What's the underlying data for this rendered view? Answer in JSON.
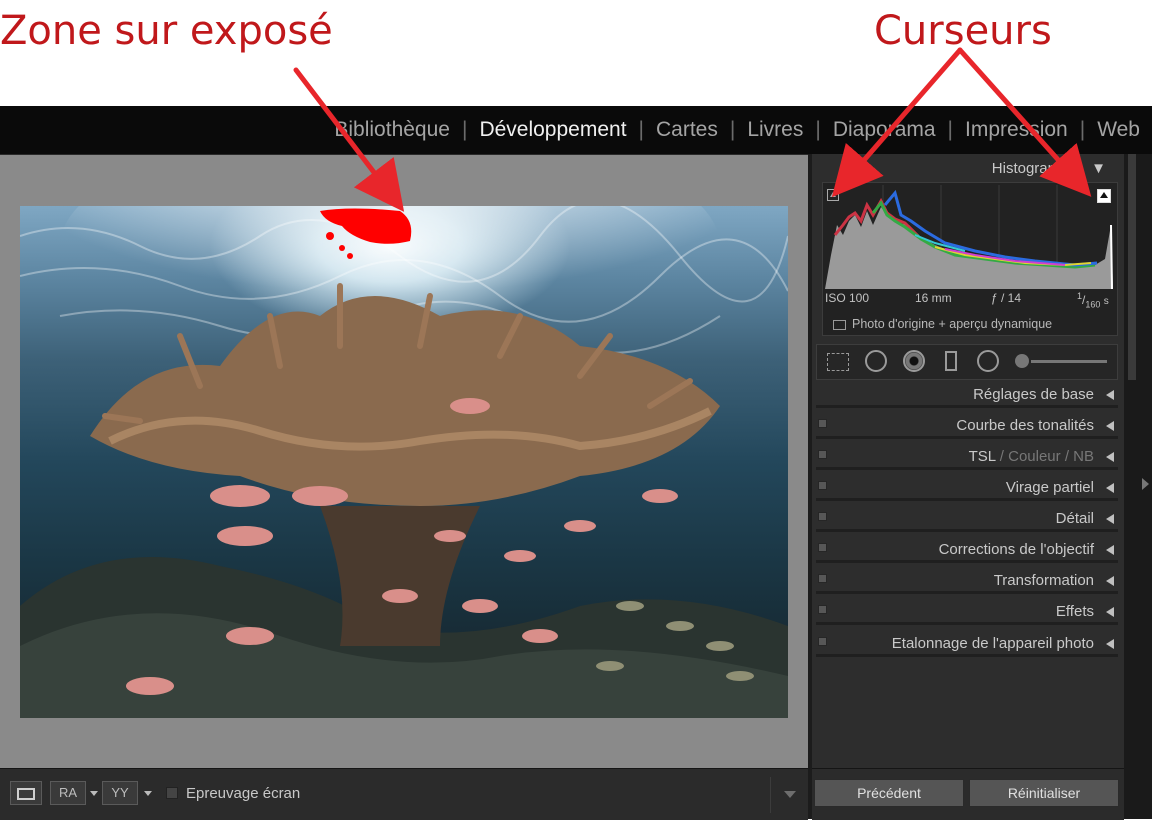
{
  "annotations": {
    "left": "Zone sur exposé",
    "right": "Curseurs"
  },
  "modules": [
    {
      "label": "Bibliothèque",
      "active": false
    },
    {
      "label": "Développement",
      "active": true
    },
    {
      "label": "Cartes",
      "active": false
    },
    {
      "label": "Livres",
      "active": false
    },
    {
      "label": "Diaporama",
      "active": false
    },
    {
      "label": "Impression",
      "active": false
    },
    {
      "label": "Web",
      "active": false
    }
  ],
  "histogram": {
    "title": "Histogramme",
    "iso": "ISO 100",
    "focal": "16 mm",
    "aperture": "ƒ / 14",
    "shutter_num": "1",
    "shutter_den": "160",
    "shutter_unit": "s",
    "original_label": "Photo d'origine + aperçu dynamique"
  },
  "panels": [
    {
      "label": "Réglages de base",
      "switch": false
    },
    {
      "label": "Courbe des tonalités",
      "switch": true
    },
    {
      "label": "TSL",
      "extra1": "Couleur",
      "extra2": "NB",
      "switch": true
    },
    {
      "label": "Virage partiel",
      "switch": true
    },
    {
      "label": "Détail",
      "switch": true
    },
    {
      "label": "Corrections de l'objectif",
      "switch": true
    },
    {
      "label": "Transformation",
      "switch": true
    },
    {
      "label": "Effets",
      "switch": true
    },
    {
      "label": "Etalonnage de l'appareil photo",
      "switch": true
    }
  ],
  "toolbar": {
    "view_ra": "RA",
    "view_yy": "YY",
    "softproof_label": "Epreuvage écran"
  },
  "buttons": {
    "previous": "Précédent",
    "reset": "Réinitialiser"
  },
  "colors": {
    "annotation": "#c0181b",
    "overexposed": "#ff0000"
  }
}
